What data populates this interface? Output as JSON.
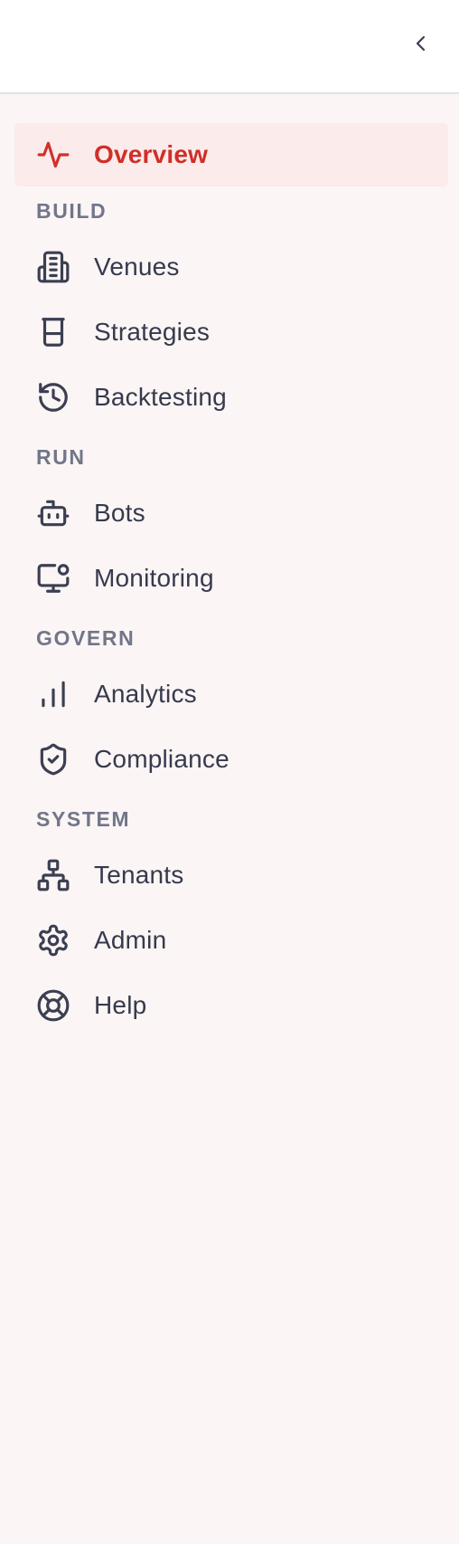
{
  "header": {
    "collapse_icon": "chevron-left-icon"
  },
  "colors": {
    "accent": "#cf2f28",
    "active_background": "#fbebea",
    "sidebar_background": "#fcf5f5",
    "text": "#363a4d",
    "section_text": "#717689"
  },
  "nav": {
    "overview": {
      "label": "Overview",
      "icon": "activity-icon",
      "active": true
    },
    "sections": [
      {
        "title": "BUILD",
        "items": [
          {
            "label": "Venues",
            "icon": "building-icon"
          },
          {
            "label": "Strategies",
            "icon": "beaker-icon"
          },
          {
            "label": "Backtesting",
            "icon": "history-icon"
          }
        ]
      },
      {
        "title": "RUN",
        "items": [
          {
            "label": "Bots",
            "icon": "bot-icon"
          },
          {
            "label": "Monitoring",
            "icon": "monitor-icon"
          }
        ]
      },
      {
        "title": "GOVERN",
        "items": [
          {
            "label": "Analytics",
            "icon": "bar-chart-icon"
          },
          {
            "label": "Compliance",
            "icon": "shield-check-icon"
          }
        ]
      },
      {
        "title": "SYSTEM",
        "items": [
          {
            "label": "Tenants",
            "icon": "network-icon"
          },
          {
            "label": "Admin",
            "icon": "gear-icon"
          },
          {
            "label": "Help",
            "icon": "life-buoy-icon"
          }
        ]
      }
    ]
  }
}
